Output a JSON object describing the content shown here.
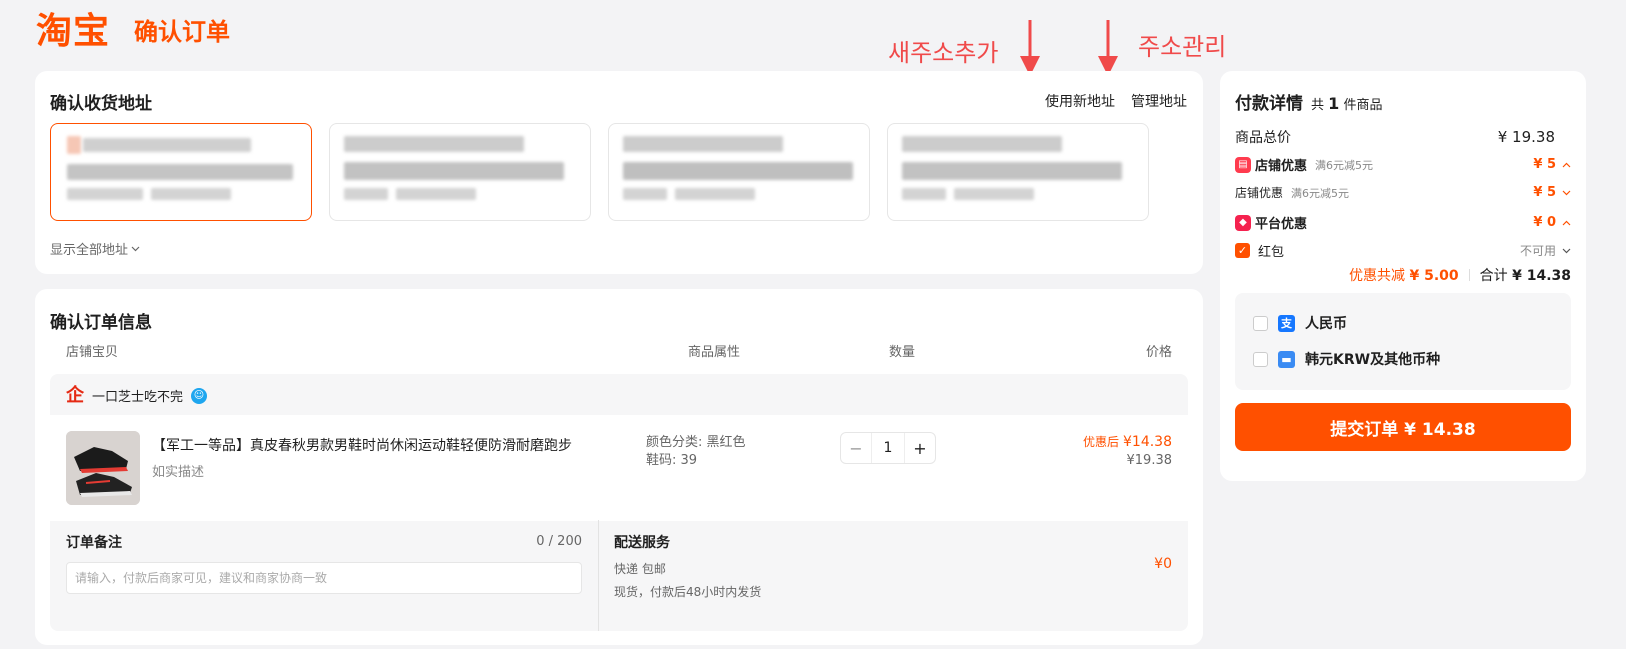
{
  "header": {
    "logo": "淘宝",
    "title": "确认订单"
  },
  "annotations": {
    "add_address": "새주소추가",
    "manage_address": "주소관리"
  },
  "address": {
    "title": "确认收货地址",
    "use_new": "使用新地址",
    "manage": "管理地址",
    "show_all": "显示全部地址"
  },
  "order": {
    "title": "确认订单信息",
    "columns": {
      "item": "店铺宝贝",
      "attrs": "商品属性",
      "qty": "数量",
      "price": "价格"
    },
    "shop_name": "一口芝士吃不完",
    "item": {
      "title": "【军工一等品】真皮春秋男款男鞋时尚休闲运动鞋轻便防滑耐磨跑步",
      "desc": "如实描述",
      "attr_color": "颜色分类: 黑红色",
      "attr_size": "鞋码: 39",
      "qty": "1",
      "price_label": "优惠后",
      "price_after": "¥14.38",
      "price_orig": "¥19.38"
    },
    "note": {
      "title": "订单备注",
      "count": "0 / 200",
      "placeholder": "请输入，付款后商家可见，建议和商家协商一致"
    },
    "shipping": {
      "title": "配送服务",
      "method": "快递 包邮",
      "desc": "现货，付款后48小时内发货",
      "price": "¥0"
    }
  },
  "payment": {
    "title": "付款详情",
    "count_prefix": "共",
    "count": "1",
    "count_suffix": "件商品",
    "total_label": "商品总价",
    "total_value": "¥ 19.38",
    "shop_discount_label": "店铺优惠",
    "shop_discount_rule": "满6元减5元",
    "shop_discount_value": "¥ 5",
    "shop_discount_sub_label": "店铺优惠",
    "shop_discount_sub_rule": "满6元减5元",
    "shop_discount_sub_value": "¥ 5",
    "platform_label": "平台优惠",
    "platform_value": "¥ 0",
    "redpacket_label": "红包",
    "redpacket_status": "不可用",
    "saved_label": "优惠共减",
    "saved_value": "¥ 5.00",
    "sum_label": "合计",
    "sum_value": "¥ 14.38",
    "method_cny": "人民币",
    "method_krw": "韩元KRW及其他币种",
    "submit": "提交订单 ¥ 14.38"
  },
  "icons": {
    "shop": "store-icon",
    "wangwang": "chat-icon",
    "alipay": "alipay-icon",
    "card": "card-icon"
  },
  "colors": {
    "accent": "#ff5000",
    "annotation": "#f04a4a",
    "background": "#f3f3f5"
  }
}
